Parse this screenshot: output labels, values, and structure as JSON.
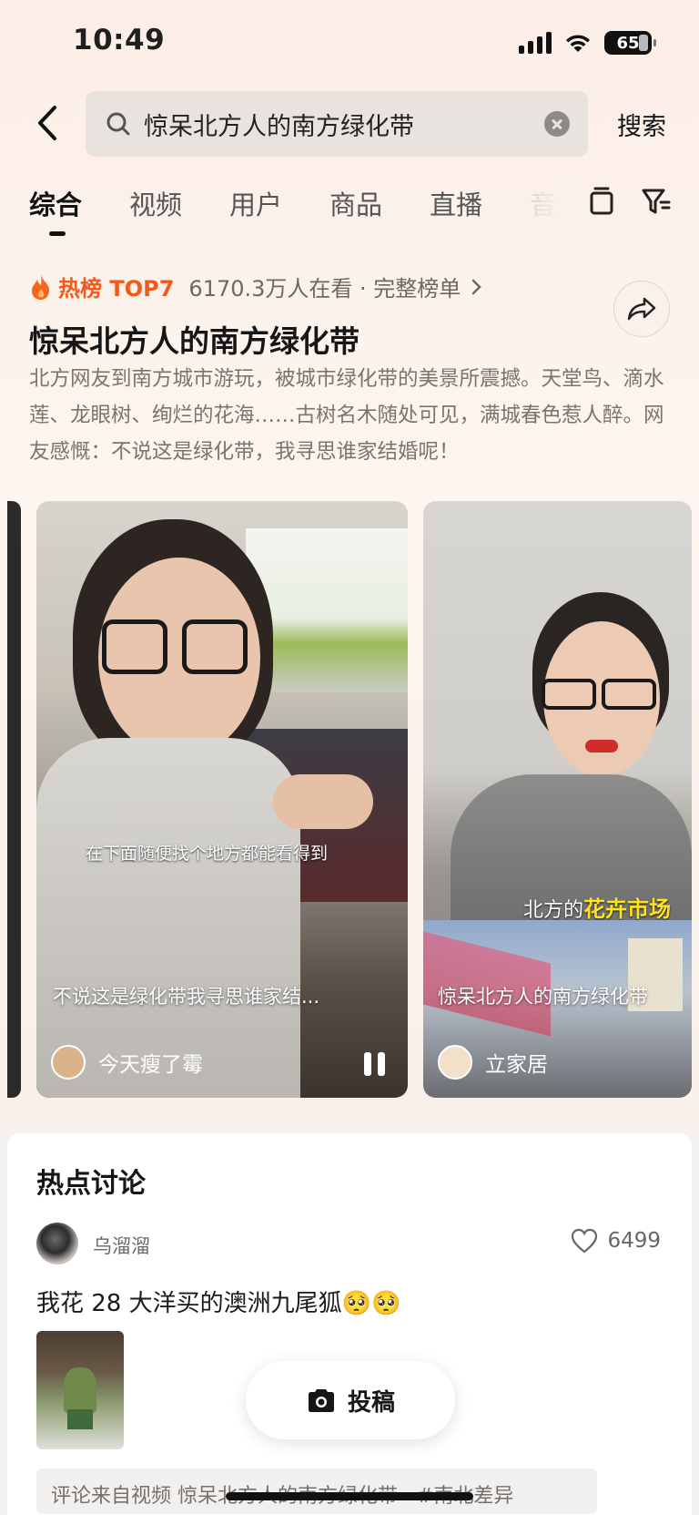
{
  "status_bar": {
    "time": "10:49",
    "battery": "65"
  },
  "search": {
    "query": "惊呆北方人的南方绿化带",
    "button_label": "搜索"
  },
  "tabs": [
    {
      "label": "综合",
      "active": true
    },
    {
      "label": "视频"
    },
    {
      "label": "用户"
    },
    {
      "label": "商品"
    },
    {
      "label": "直播"
    },
    {
      "label": "音乐"
    }
  ],
  "topic": {
    "badge": "热榜 TOP7",
    "meta": "6170.3万人在看 · 完整榜单",
    "title": "惊呆北方人的南方绿化带",
    "description": "北方网友到南方城市游玩，被城市绿化带的美景所震撼。天堂鸟、滴水莲、龙眼树、绚烂的花海……古树名木随处可见，满城春色惹人醉。网友感慨：不说这是绿化带，我寻思谁家结婚呢！"
  },
  "videos": [
    {
      "subtitle": "在下面随便找个地方都能看得到",
      "caption": "不说这是绿化带我寻思谁家结...",
      "author": "今天瘦了霉"
    },
    {
      "subtitle_prefix": "北方的",
      "subtitle_highlight": "花卉市场",
      "caption": "惊呆北方人的南方绿化带",
      "author": "立家居"
    }
  ],
  "discussion": {
    "title": "热点讨论",
    "user": "乌溜溜",
    "likes": "6499",
    "text": "我花 28 大洋买的澳洲九尾狐🥺🥺",
    "source": "评论来自视频 惊呆北方人的南方绿化带 · #南北差异"
  },
  "post_button": "投稿",
  "colors": {
    "accent": "#f25a1b",
    "highlight": "#ffe31a"
  }
}
